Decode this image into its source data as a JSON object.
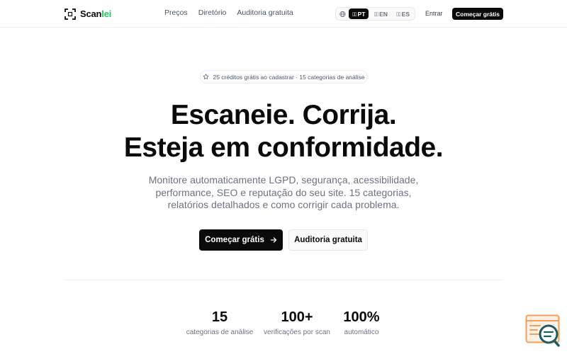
{
  "header": {
    "logo": {
      "text_main": "Scan",
      "text_accent": "lei"
    },
    "nav": [
      {
        "label": "Preços"
      },
      {
        "label": "Diretório"
      },
      {
        "label": "Auditoria gratuita"
      }
    ],
    "languages": [
      {
        "code": "PT",
        "flag": "▯▯",
        "active": true
      },
      {
        "code": "EN",
        "flag": "▯▯",
        "active": false
      },
      {
        "code": "ES",
        "flag": "▯▯",
        "active": false
      }
    ],
    "login_label": "Entrar",
    "cta_label": "Começar grátis"
  },
  "hero": {
    "badge": "25 créditos grátis ao cadastrar · 15 categorias de análise",
    "title_line1": "Escaneie. Corrija.",
    "title_line2": "Esteja em conformidade.",
    "subtitle": "Monitore automaticamente LGPD, segurança, acessibilidade, performance, SEO e reputação do seu site. 15 categorias, relatórios detalhados e como corrigir cada problema.",
    "primary_cta": "Começar grátis",
    "secondary_cta": "Auditoria gratuita"
  },
  "stats": [
    {
      "value": "15",
      "label": "categorias de análise"
    },
    {
      "value": "100+",
      "label": "verificações por scan"
    },
    {
      "value": "100%",
      "label": "automático"
    }
  ],
  "colors": {
    "accent": "#22c55e",
    "primary": "#0a0a0a",
    "muted_text": "#6b7280",
    "widget_orange": "#f59e58",
    "widget_teal": "#1f5c5e"
  },
  "icons": {
    "logo": "scan-frame-icon",
    "language": "globe-icon",
    "badge": "star-icon",
    "primary_cta": "arrow-right-icon",
    "widget": "search-report-icon"
  }
}
